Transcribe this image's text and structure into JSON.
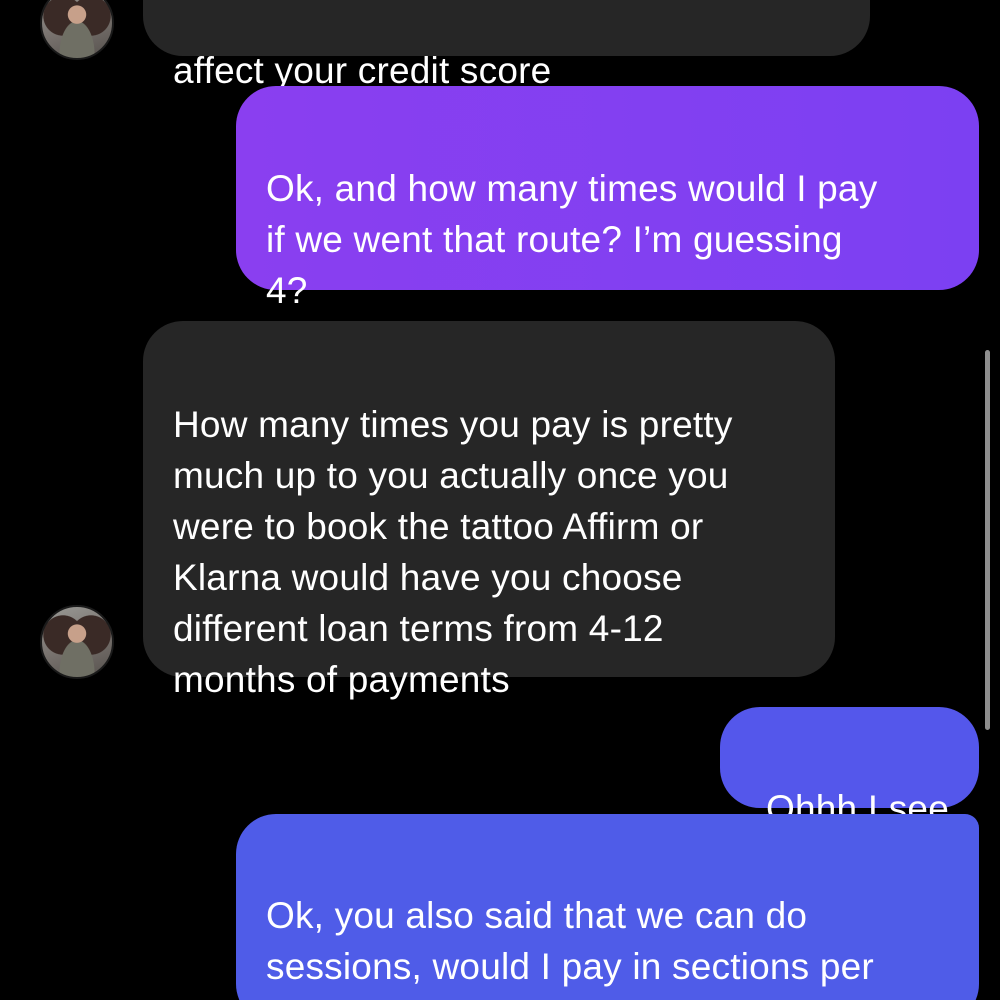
{
  "colors": {
    "background": "#000000",
    "incoming_bubble": "#262626",
    "outgoing_purple": "#7b3ff0",
    "outgoing_blue": "#4f5ce8",
    "text": "#ffffff"
  },
  "messages": [
    {
      "sender": "them",
      "text": "affect your credit score"
    },
    {
      "sender": "me",
      "text": "Ok, and how many times would I pay\nif we went that route? I’m guessing\n4?"
    },
    {
      "sender": "them",
      "text": "How many times you pay is pretty\nmuch up to you actually once you\nwere to book the tattoo Affirm or\nKlarna would have you choose\ndifferent loan terms from 4-12\nmonths of payments"
    },
    {
      "sender": "me",
      "text": "Ohhh I see"
    },
    {
      "sender": "me",
      "text": "Ok, you also said that we can do\nsessions, would I pay in sections per\nsession?"
    }
  ],
  "avatar_icon": "profile-photo"
}
